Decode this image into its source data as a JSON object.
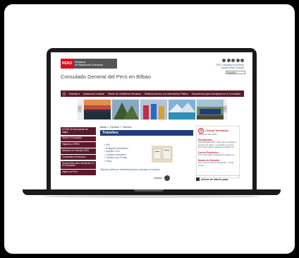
{
  "site": {
    "logo_peru": "PERÚ",
    "logo_ministry_line1": "Ministerio",
    "logo_ministry_line2": "de Relaciones Exteriores",
    "title": "Consulado General del Perú en Bilbao",
    "header_small_line1": "PRO Consulado en la Barra",
    "header_small_line2": "Acceso Sede Consular",
    "lang_select": "Español"
  },
  "nav": {
    "items": [
      {
        "label": "Trámites ▾"
      },
      {
        "label": "Asistencia Consular"
      },
      {
        "label": "Redes de Científicos Peruanos"
      },
      {
        "label": "Solicitud Acceso a la Información Pública"
      },
      {
        "label": "Documentos para Inscripción en el Consulado"
      }
    ]
  },
  "carousel": {
    "prev": "‹",
    "next": "›"
  },
  "sidebar": {
    "items": [
      {
        "label": "COVID-19 Información de Viajes"
      },
      {
        "label": "Sobre el Consulado"
      },
      {
        "label": "Viajando a PERÚ"
      },
      {
        "label": "Atención en Trámites 2023"
      },
      {
        "label": "Consulados Honorarios"
      },
      {
        "label": "Documentos para inscripción en el Consulado"
      },
      {
        "label": "Ingreso al Perú"
      }
    ]
  },
  "main": {
    "breadcrumb_home": "Inicio",
    "breadcrumb_rest": " » Trámites » Trámites",
    "title": "Trámites",
    "links": [
      {
        "label": "DNI"
      },
      {
        "label": "Pasaporte Biométrico"
      },
      {
        "label": "Registro Civil"
      },
      {
        "label": "Trámites Notariales"
      },
      {
        "label": "Trámites con Firmas"
      },
      {
        "label": "Visas"
      }
    ],
    "note": "Tabla de tarifas por trámites/servicios consulares en bancos",
    "footer_label": "Imprimir"
  },
  "right_panel": {
    "heading": "Central Telefónica",
    "phone": "(0034) 94 441 2245",
    "emergency_title": "Emergencias",
    "emergency_text": "(0034) 662043357. Sólo para contactos y emisión de datos. Consultas al correo:",
    "emergency_email": "informacion@consuladoperu-bilbao.es",
    "email_title": "Correo Electrónico",
    "email": "informacion@consuladoperu-bilbao.es",
    "hours_title": "Horario de Atención",
    "hours_text": "Del Lunes a Viernes de 09:00 – 13:00 horas",
    "avisos": "Avisos de interés para"
  },
  "colors": {
    "nav": "#5a1a2a",
    "title_bar": "#1f3d7a",
    "accent_red": "#c21f2e"
  }
}
